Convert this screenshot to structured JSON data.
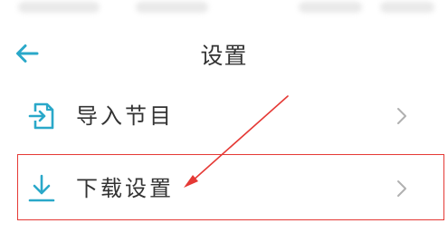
{
  "header": {
    "title": "设置",
    "back_icon": "arrow-left-icon"
  },
  "settings": {
    "items": [
      {
        "label": "导入节目",
        "icon": "import-file-icon"
      },
      {
        "label": "下载设置",
        "icon": "download-icon"
      }
    ]
  },
  "colors": {
    "accent": "#2aa8c9",
    "text": "#333333",
    "annotation": "#e53935",
    "chevron": "#b0b0b0"
  }
}
